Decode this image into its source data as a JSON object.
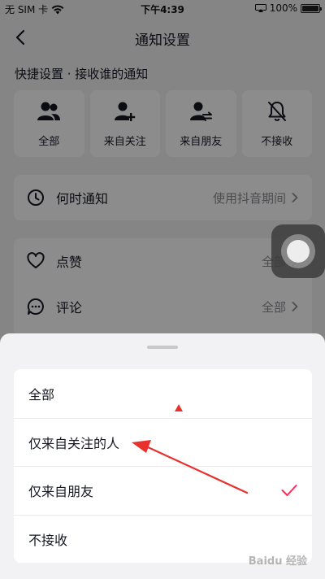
{
  "status_bar": {
    "carrier": "无 SIM 卡",
    "time": "下午4:39",
    "battery": "100%",
    "battery_level": 1.0
  },
  "nav": {
    "title": "通知设置"
  },
  "quick_settings": {
    "title": "快捷设置 · 接收谁的通知",
    "items": [
      {
        "label": "全部",
        "icon": "group-icon"
      },
      {
        "label": "来自关注",
        "icon": "add-user-icon"
      },
      {
        "label": "来自朋友",
        "icon": "friend-swap-icon"
      },
      {
        "label": "不接收",
        "icon": "bell-off-icon"
      }
    ]
  },
  "when_notify": {
    "label": "何时通知",
    "value": "使用抖音期间",
    "icon": "clock-icon"
  },
  "notification_rows": [
    {
      "label": "点赞",
      "value": "全部",
      "icon": "heart-icon"
    },
    {
      "label": "评论",
      "value": "全部",
      "icon": "comment-icon"
    }
  ],
  "sheet": {
    "options": [
      {
        "label": "全部",
        "selected": false
      },
      {
        "label": "仅来自关注的人",
        "selected": false
      },
      {
        "label": "仅来自朋友",
        "selected": true
      },
      {
        "label": "不接收",
        "selected": false
      }
    ]
  },
  "colors": {
    "accent": "#fe2c55",
    "annotation_red": "#e8312f"
  },
  "watermark": "Baidu 经验"
}
